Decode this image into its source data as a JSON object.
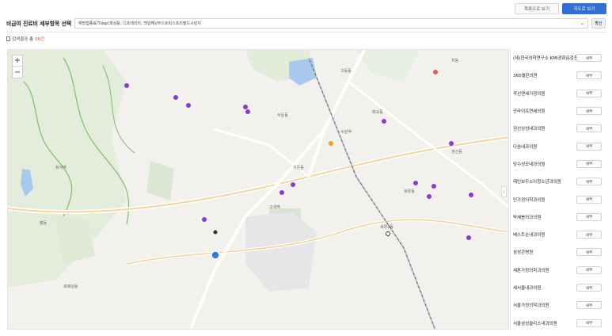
{
  "view_buttons": {
    "list": "목록으로 보기",
    "map": "지도로 보기"
  },
  "header": {
    "title": "비급여 진료비 세부항목 선택",
    "select_value": "예방접종료/Tdap(파상풍, 디프테리아, 백일해)/부스트릭스프리필드시린지",
    "confirm": "확인"
  },
  "result": {
    "prefix": "검색결과 총",
    "count": "56건"
  },
  "map": {
    "zoom_in": "+",
    "zoom_out": "−",
    "collapse": "›"
  },
  "clinics": [
    {
      "name": "(재)한국의학연구소 KMI광화문검진센터",
      "btn": "세부"
    },
    {
      "name": "365엘린의원",
      "btn": "세부"
    },
    {
      "name": "곽선엔세가정의원",
      "btn": "세부"
    },
    {
      "name": "굿라이프연세의원",
      "btn": "세부"
    },
    {
      "name": "권선상성내과의원",
      "btn": "세부"
    },
    {
      "name": "다솜내과의원",
      "btn": "세부"
    },
    {
      "name": "당수성모내과의원",
      "btn": "세부"
    },
    {
      "name": "레인보우소아청소년과의원",
      "btn": "세부"
    },
    {
      "name": "민가정의학과의원",
      "btn": "세부"
    },
    {
      "name": "박혜봉외과의원",
      "btn": "세부"
    },
    {
      "name": "베스트손내과의원",
      "btn": "세부"
    },
    {
      "name": "삼성콘병원",
      "btn": "세부"
    },
    {
      "name": "세론가정의학과의원",
      "btn": "세부"
    },
    {
      "name": "세서울내과의원",
      "btn": "세부"
    },
    {
      "name": "서울가정의학과의원",
      "btn": "세부"
    },
    {
      "name": "서울삼성클리스내과의원",
      "btn": "세부"
    }
  ],
  "map_labels": [
    "서둔동",
    "세류2동",
    "세류동",
    "고색역",
    "매교동",
    "수원역",
    "평동",
    "고등동",
    "화서역",
    "호매실동",
    "지동",
    "권선동",
    "서둔동"
  ],
  "colors": {
    "accent": "#2f6fd6",
    "marker": "#8a3ad3",
    "count": "#e2533a"
  }
}
